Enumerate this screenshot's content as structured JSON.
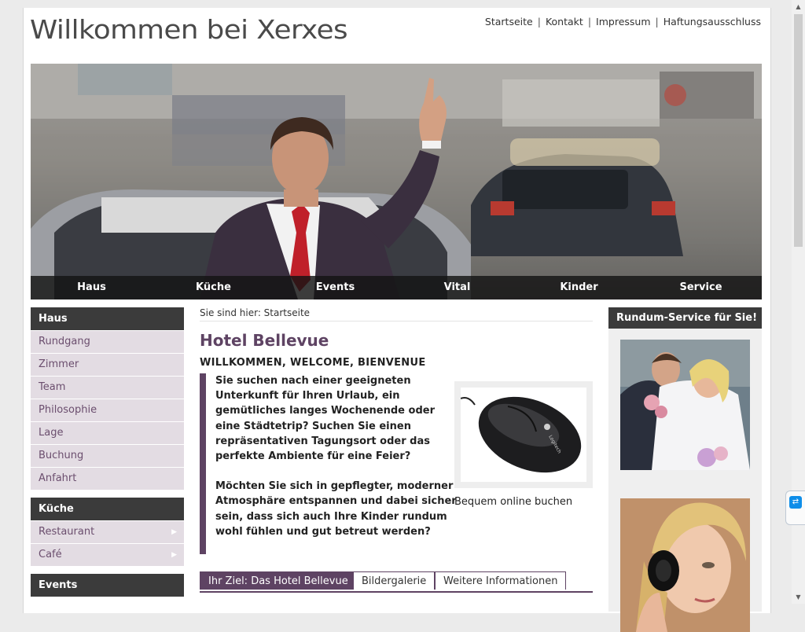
{
  "header": {
    "title": "Willkommen bei Xerxes",
    "topnav": [
      "Startseite",
      "Kontakt",
      "Impressum",
      "Haftungsausschluss"
    ]
  },
  "mainnav": [
    "Haus",
    "Küche",
    "Events",
    "Vital",
    "Kinder",
    "Service"
  ],
  "sidebar": {
    "groups": [
      {
        "title": "Haus",
        "items": [
          {
            "label": "Rundgang",
            "arrow": false
          },
          {
            "label": "Zimmer",
            "arrow": false
          },
          {
            "label": "Team",
            "arrow": false
          },
          {
            "label": "Philosophie",
            "arrow": false
          },
          {
            "label": "Lage",
            "arrow": false
          },
          {
            "label": "Buchung",
            "arrow": false
          },
          {
            "label": "Anfahrt",
            "arrow": false
          }
        ]
      },
      {
        "title": "Küche",
        "items": [
          {
            "label": "Restaurant",
            "arrow": true
          },
          {
            "label": "Café",
            "arrow": true
          }
        ]
      },
      {
        "title": "Events",
        "items": []
      }
    ]
  },
  "main": {
    "breadcrumb": "Sie sind hier: Startseite",
    "title": "Hotel Bellevue",
    "welcome": "WILLKOMMEN, WELCOME, BIENVENUE",
    "paragraph1": "Sie suchen nach einer geeigneten Unterkunft für Ihren Urlaub, ein gemütliches langes Wochenende oder eine Städtetrip? Suchen Sie einen repräsentativen Tagungsort oder das perfekte Ambiente für eine Feier?",
    "paragraph2": "Möchten Sie sich in gepflegter, moderner Atmosphäre entspannen und dabei sicher sein, dass sich auch Ihre Kinder rundum wohl fühlen und gut betreut werden?",
    "image_caption": "Bequem online buchen",
    "mouse_logo": "Logitech",
    "tabs": [
      {
        "label": "Ihr Ziel: Das Hotel Bellevue",
        "active": true
      },
      {
        "label": "Bildergalerie",
        "active": false
      },
      {
        "label": "Weitere Informationen",
        "active": false
      }
    ]
  },
  "rightbar": {
    "title": "Rundum-Service für Sie!"
  },
  "colors": {
    "accent": "#5e4363",
    "sidebar_item_bg": "#e3dce3",
    "header_bar": "#3b3b3b"
  }
}
